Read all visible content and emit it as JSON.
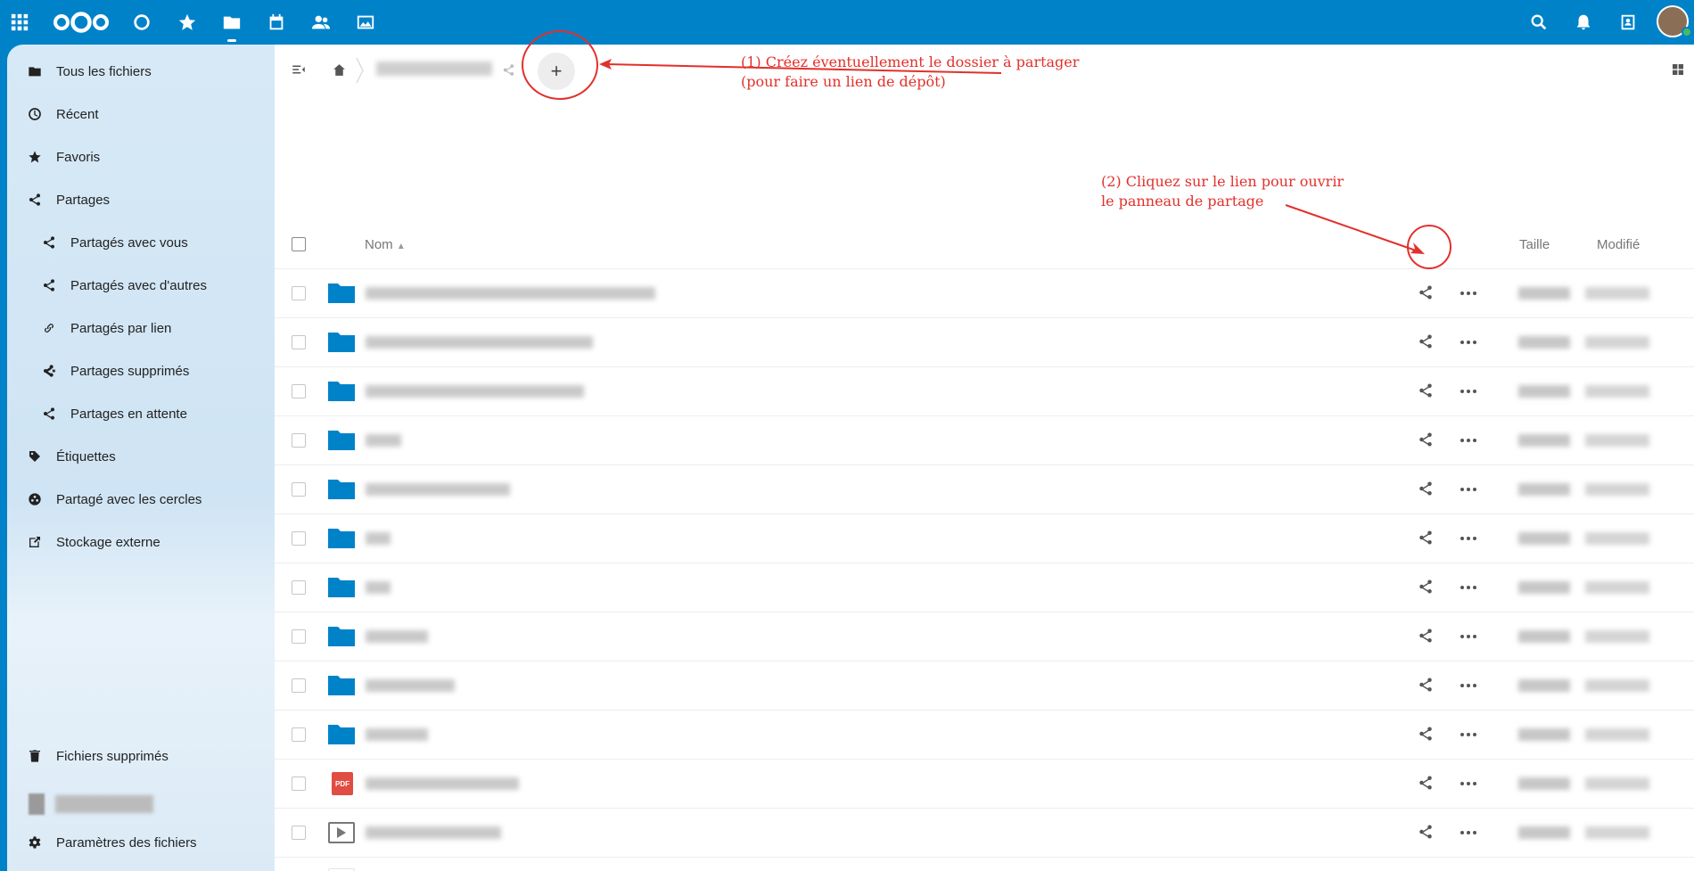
{
  "header": {
    "apps": [
      "apps-menu-icon",
      "nextcloud-logo",
      "dashboard-icon",
      "favorites-star-icon",
      "files-icon",
      "calendar-icon",
      "contacts-icon",
      "photos-icon"
    ],
    "right_icons": [
      "search-icon",
      "notifications-icon",
      "contacts-menu-icon"
    ]
  },
  "sidebar": {
    "items": [
      {
        "label": "Tous les fichiers",
        "icon": "folder-icon"
      },
      {
        "label": "Récent",
        "icon": "clock-icon"
      },
      {
        "label": "Favoris",
        "icon": "star-icon"
      },
      {
        "label": "Partages",
        "icon": "share-icon"
      },
      {
        "label": "Partagés avec vous",
        "icon": "share-icon"
      },
      {
        "label": "Partagés avec d'autres",
        "icon": "share-icon"
      },
      {
        "label": "Partagés par lien",
        "icon": "link-icon"
      },
      {
        "label": "Partages supprimés",
        "icon": "share-deleted-icon"
      },
      {
        "label": "Partages en attente",
        "icon": "share-icon"
      },
      {
        "label": "Étiquettes",
        "icon": "tag-icon"
      },
      {
        "label": "Partagé avec les cercles",
        "icon": "circles-icon"
      },
      {
        "label": "Stockage externe",
        "icon": "external-storage-icon"
      }
    ],
    "trash": "Fichiers supprimés",
    "settings": "Paramètres des fichiers"
  },
  "toolbar": {
    "new_button": "+"
  },
  "table": {
    "col_name": "Nom",
    "col_size": "Taille",
    "col_modified": "Modifié",
    "rows": [
      {
        "type": "folder"
      },
      {
        "type": "folder"
      },
      {
        "type": "folder"
      },
      {
        "type": "folder"
      },
      {
        "type": "folder"
      },
      {
        "type": "folder"
      },
      {
        "type": "folder"
      },
      {
        "type": "folder"
      },
      {
        "type": "folder"
      },
      {
        "type": "folder"
      },
      {
        "type": "pdf",
        "badge": "PDF"
      },
      {
        "type": "video"
      },
      {
        "type": "document"
      }
    ]
  },
  "annotations": {
    "note1_line1": "(1) Créez éventuellement le dossier à partager",
    "note1_line2": "(pour faire un lien de dépôt)",
    "note2_line1": "(2) Cliquez sur le lien pour ouvrir",
    "note2_line2": "le panneau de partage",
    "color": "#e2302b"
  },
  "colors": {
    "brand": "#0082c9",
    "folder": "#0082c9",
    "pdf": "#e04d42"
  }
}
